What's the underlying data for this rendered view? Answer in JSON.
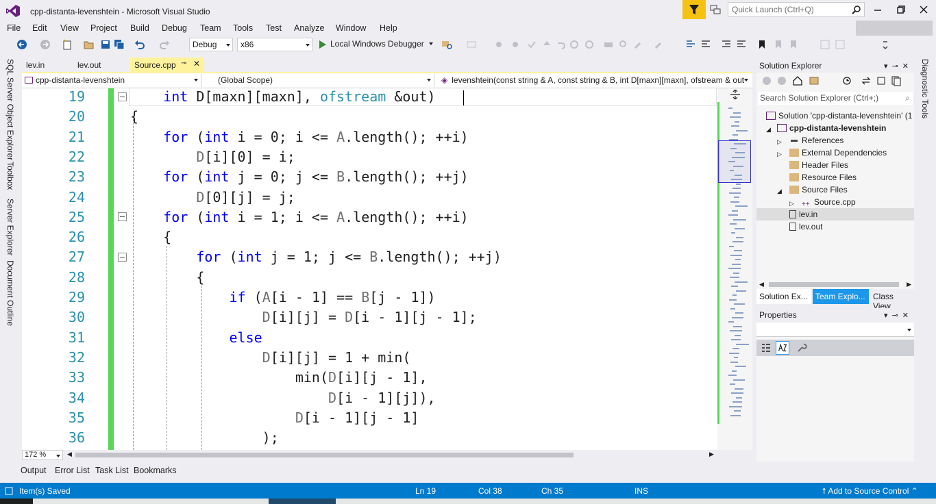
{
  "window": {
    "title": "cpp-distanta-levenshtein - Microsoft Visual Studio",
    "quick_launch_placeholder": "Quick Launch (Ctrl+Q)"
  },
  "menu": [
    "File",
    "Edit",
    "View",
    "Project",
    "Build",
    "Debug",
    "Team",
    "Tools",
    "Test",
    "Analyze",
    "Window",
    "Help"
  ],
  "toolbar": {
    "configuration": "Debug",
    "platform": "x86",
    "run_label": "Local Windows Debugger"
  },
  "left_rail": [
    "SQL Server Object Explorer",
    "Toolbox",
    "Server Explorer",
    "Document Outline"
  ],
  "right_rail": [
    "Diagnostic Tools"
  ],
  "doc_tabs": [
    {
      "label": "lev.in",
      "active": false
    },
    {
      "label": "lev.out",
      "active": false
    },
    {
      "label": "Source.cpp",
      "active": true
    }
  ],
  "navbar": {
    "project": "cpp-distanta-levenshtein",
    "scope": "(Global Scope)",
    "member": "levenshtein(const string & A, const string & B, int D[maxn][maxn], ofstream & out"
  },
  "editor": {
    "zoom": "172 %",
    "lines": [
      {
        "n": "19",
        "html": "    <span class=\"kw\">int</span> D[maxn][maxn], <span class=\"ty\">ofstream</span> &amp;out)"
      },
      {
        "n": "20",
        "html": "{"
      },
      {
        "n": "21",
        "html": "    <span class=\"kw\">for</span> (<span class=\"kw\">int</span> i = 0; i &lt;= <span class=\"gr\">A</span>.length(); ++i)"
      },
      {
        "n": "22",
        "html": "        <span class=\"gr\">D</span>[i][0] = i;"
      },
      {
        "n": "23",
        "html": "    <span class=\"kw\">for</span> (<span class=\"kw\">int</span> j = 0; j &lt;= <span class=\"gr\">B</span>.length(); ++j)"
      },
      {
        "n": "24",
        "html": "        <span class=\"gr\">D</span>[0][j] = j;"
      },
      {
        "n": "25",
        "html": "    <span class=\"kw\">for</span> (<span class=\"kw\">int</span> i = 1; i &lt;= <span class=\"gr\">A</span>.length(); ++i)"
      },
      {
        "n": "26",
        "html": "    {"
      },
      {
        "n": "27",
        "html": "        <span class=\"kw\">for</span> (<span class=\"kw\">int</span> j = 1; j &lt;= <span class=\"gr\">B</span>.length(); ++j)"
      },
      {
        "n": "28",
        "html": "        {"
      },
      {
        "n": "29",
        "html": "            <span class=\"kw\">if</span> (<span class=\"gr\">A</span>[i - 1] == <span class=\"gr\">B</span>[j - 1])"
      },
      {
        "n": "30",
        "html": "                <span class=\"gr\">D</span>[i][j] = <span class=\"gr\">D</span>[i - 1][j - 1];"
      },
      {
        "n": "31",
        "html": "            <span class=\"kw\">else</span>"
      },
      {
        "n": "32",
        "html": "                <span class=\"gr\">D</span>[i][j] = 1 + min("
      },
      {
        "n": "33",
        "html": "                    min(<span class=\"gr\">D</span>[i][j - 1],"
      },
      {
        "n": "34",
        "html": "                        <span class=\"gr\">D</span>[i - 1][j]),"
      },
      {
        "n": "35",
        "html": "                    <span class=\"gr\">D</span>[i - 1][j - 1]"
      },
      {
        "n": "36",
        "html": "                );"
      }
    ]
  },
  "solution_explorer": {
    "title": "Solution Explorer",
    "search_placeholder": "Search Solution Explorer (Ctrl+;)",
    "items": [
      {
        "label": "Solution 'cpp-distanta-levenshtein' (1",
        "bold": false
      },
      {
        "label": "cpp-distanta-levenshtein",
        "bold": true
      },
      {
        "label": "References",
        "bold": false
      },
      {
        "label": "External Dependencies",
        "bold": false
      },
      {
        "label": "Header Files",
        "bold": false
      },
      {
        "label": "Resource Files",
        "bold": false
      },
      {
        "label": "Source Files",
        "bold": false
      },
      {
        "label": "Source.cpp",
        "bold": false
      },
      {
        "label": "lev.in",
        "bold": false
      },
      {
        "label": "lev.out",
        "bold": false
      }
    ],
    "tabs": [
      "Solution Ex...",
      "Team Explo...",
      "Class View"
    ]
  },
  "properties": {
    "title": "Properties"
  },
  "bottom_tabs": [
    "Output",
    "Error List",
    "Task List",
    "Bookmarks"
  ],
  "status": {
    "message": "Item(s) Saved",
    "ln": "Ln 19",
    "col": "Col 38",
    "ch": "Ch 35",
    "mode": "INS",
    "source_control": "Add to Source Control"
  },
  "colors": {
    "accent": "#007acc",
    "active_tab": "#fff29d",
    "change_bar": "#57d657",
    "keyword": "#0000ff",
    "type": "#2b91af"
  }
}
